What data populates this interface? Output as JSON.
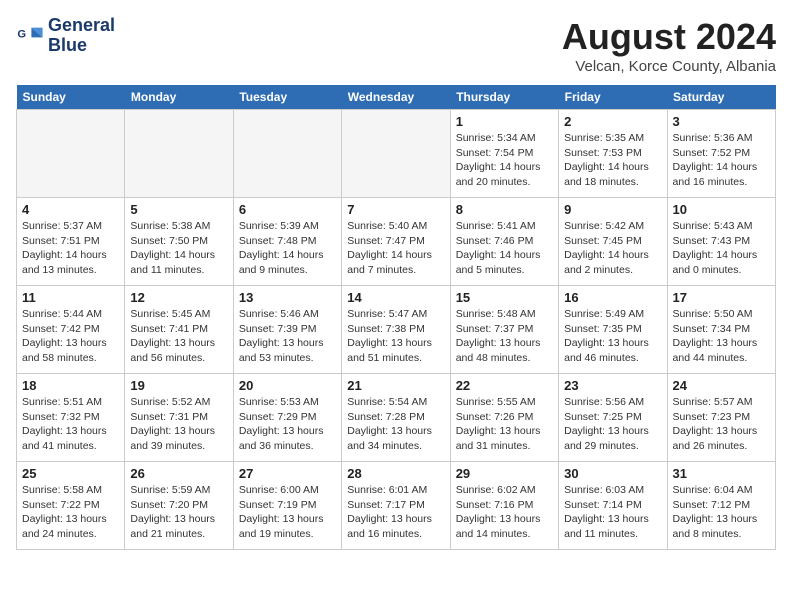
{
  "header": {
    "logo_line1": "General",
    "logo_line2": "Blue",
    "month_year": "August 2024",
    "location": "Velcan, Korce County, Albania"
  },
  "weekdays": [
    "Sunday",
    "Monday",
    "Tuesday",
    "Wednesday",
    "Thursday",
    "Friday",
    "Saturday"
  ],
  "weeks": [
    [
      {
        "day": "",
        "info": ""
      },
      {
        "day": "",
        "info": ""
      },
      {
        "day": "",
        "info": ""
      },
      {
        "day": "",
        "info": ""
      },
      {
        "day": "1",
        "info": "Sunrise: 5:34 AM\nSunset: 7:54 PM\nDaylight: 14 hours\nand 20 minutes."
      },
      {
        "day": "2",
        "info": "Sunrise: 5:35 AM\nSunset: 7:53 PM\nDaylight: 14 hours\nand 18 minutes."
      },
      {
        "day": "3",
        "info": "Sunrise: 5:36 AM\nSunset: 7:52 PM\nDaylight: 14 hours\nand 16 minutes."
      }
    ],
    [
      {
        "day": "4",
        "info": "Sunrise: 5:37 AM\nSunset: 7:51 PM\nDaylight: 14 hours\nand 13 minutes."
      },
      {
        "day": "5",
        "info": "Sunrise: 5:38 AM\nSunset: 7:50 PM\nDaylight: 14 hours\nand 11 minutes."
      },
      {
        "day": "6",
        "info": "Sunrise: 5:39 AM\nSunset: 7:48 PM\nDaylight: 14 hours\nand 9 minutes."
      },
      {
        "day": "7",
        "info": "Sunrise: 5:40 AM\nSunset: 7:47 PM\nDaylight: 14 hours\nand 7 minutes."
      },
      {
        "day": "8",
        "info": "Sunrise: 5:41 AM\nSunset: 7:46 PM\nDaylight: 14 hours\nand 5 minutes."
      },
      {
        "day": "9",
        "info": "Sunrise: 5:42 AM\nSunset: 7:45 PM\nDaylight: 14 hours\nand 2 minutes."
      },
      {
        "day": "10",
        "info": "Sunrise: 5:43 AM\nSunset: 7:43 PM\nDaylight: 14 hours\nand 0 minutes."
      }
    ],
    [
      {
        "day": "11",
        "info": "Sunrise: 5:44 AM\nSunset: 7:42 PM\nDaylight: 13 hours\nand 58 minutes."
      },
      {
        "day": "12",
        "info": "Sunrise: 5:45 AM\nSunset: 7:41 PM\nDaylight: 13 hours\nand 56 minutes."
      },
      {
        "day": "13",
        "info": "Sunrise: 5:46 AM\nSunset: 7:39 PM\nDaylight: 13 hours\nand 53 minutes."
      },
      {
        "day": "14",
        "info": "Sunrise: 5:47 AM\nSunset: 7:38 PM\nDaylight: 13 hours\nand 51 minutes."
      },
      {
        "day": "15",
        "info": "Sunrise: 5:48 AM\nSunset: 7:37 PM\nDaylight: 13 hours\nand 48 minutes."
      },
      {
        "day": "16",
        "info": "Sunrise: 5:49 AM\nSunset: 7:35 PM\nDaylight: 13 hours\nand 46 minutes."
      },
      {
        "day": "17",
        "info": "Sunrise: 5:50 AM\nSunset: 7:34 PM\nDaylight: 13 hours\nand 44 minutes."
      }
    ],
    [
      {
        "day": "18",
        "info": "Sunrise: 5:51 AM\nSunset: 7:32 PM\nDaylight: 13 hours\nand 41 minutes."
      },
      {
        "day": "19",
        "info": "Sunrise: 5:52 AM\nSunset: 7:31 PM\nDaylight: 13 hours\nand 39 minutes."
      },
      {
        "day": "20",
        "info": "Sunrise: 5:53 AM\nSunset: 7:29 PM\nDaylight: 13 hours\nand 36 minutes."
      },
      {
        "day": "21",
        "info": "Sunrise: 5:54 AM\nSunset: 7:28 PM\nDaylight: 13 hours\nand 34 minutes."
      },
      {
        "day": "22",
        "info": "Sunrise: 5:55 AM\nSunset: 7:26 PM\nDaylight: 13 hours\nand 31 minutes."
      },
      {
        "day": "23",
        "info": "Sunrise: 5:56 AM\nSunset: 7:25 PM\nDaylight: 13 hours\nand 29 minutes."
      },
      {
        "day": "24",
        "info": "Sunrise: 5:57 AM\nSunset: 7:23 PM\nDaylight: 13 hours\nand 26 minutes."
      }
    ],
    [
      {
        "day": "25",
        "info": "Sunrise: 5:58 AM\nSunset: 7:22 PM\nDaylight: 13 hours\nand 24 minutes."
      },
      {
        "day": "26",
        "info": "Sunrise: 5:59 AM\nSunset: 7:20 PM\nDaylight: 13 hours\nand 21 minutes."
      },
      {
        "day": "27",
        "info": "Sunrise: 6:00 AM\nSunset: 7:19 PM\nDaylight: 13 hours\nand 19 minutes."
      },
      {
        "day": "28",
        "info": "Sunrise: 6:01 AM\nSunset: 7:17 PM\nDaylight: 13 hours\nand 16 minutes."
      },
      {
        "day": "29",
        "info": "Sunrise: 6:02 AM\nSunset: 7:16 PM\nDaylight: 13 hours\nand 14 minutes."
      },
      {
        "day": "30",
        "info": "Sunrise: 6:03 AM\nSunset: 7:14 PM\nDaylight: 13 hours\nand 11 minutes."
      },
      {
        "day": "31",
        "info": "Sunrise: 6:04 AM\nSunset: 7:12 PM\nDaylight: 13 hours\nand 8 minutes."
      }
    ]
  ]
}
